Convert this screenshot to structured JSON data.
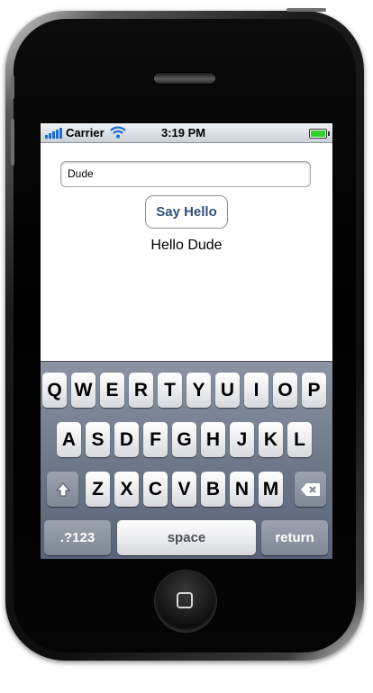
{
  "device": {
    "model": "iphone",
    "home_button_icon": "square-icon"
  },
  "status_bar": {
    "carrier": "Carrier",
    "time": "3:19 PM",
    "signal_icon": "signal-bars-icon",
    "wifi_icon": "wifi-icon",
    "battery_icon": "battery-icon",
    "battery_color": "#2fd12f"
  },
  "app": {
    "name_field_value": "Dude",
    "say_hello_label": "Say Hello",
    "greeting": "Hello Dude",
    "button_text_color": "#32507c"
  },
  "keyboard": {
    "row1": [
      "Q",
      "W",
      "E",
      "R",
      "T",
      "Y",
      "U",
      "I",
      "O",
      "P"
    ],
    "row2": [
      "A",
      "S",
      "D",
      "F",
      "G",
      "H",
      "J",
      "K",
      "L"
    ],
    "row3": [
      "Z",
      "X",
      "C",
      "V",
      "B",
      "N",
      "M"
    ],
    "shift_icon": "shift-arrow-icon",
    "delete_icon": "delete-backspace-icon",
    "numbers_label": ".?123",
    "space_label": "space",
    "return_label": "return"
  }
}
